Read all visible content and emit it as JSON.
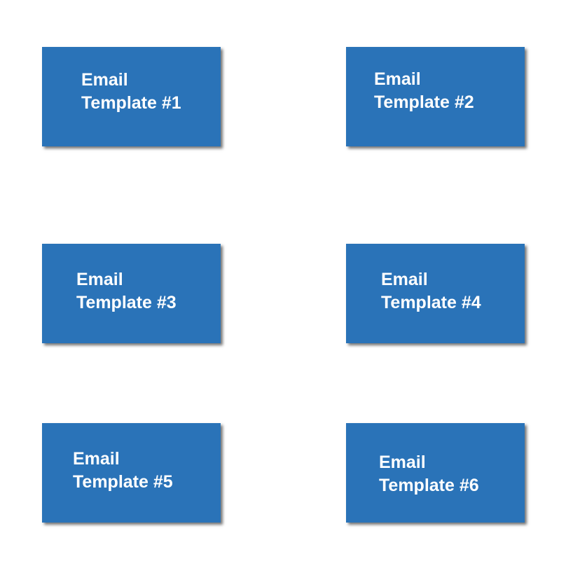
{
  "tiles": [
    {
      "line1": "Email",
      "line2": "Template #1"
    },
    {
      "line1": "Email",
      "line2": "Template #2"
    },
    {
      "line1": "Email",
      "line2": "Template #3"
    },
    {
      "line1": "Email",
      "line2": "Template #4"
    },
    {
      "line1": "Email",
      "line2": "Template #5"
    },
    {
      "line1": "Email",
      "line2": "Template #6"
    }
  ],
  "colors": {
    "tile_fill": "#2a73b8",
    "tile_text": "#ffffff",
    "background": "#ffffff"
  }
}
